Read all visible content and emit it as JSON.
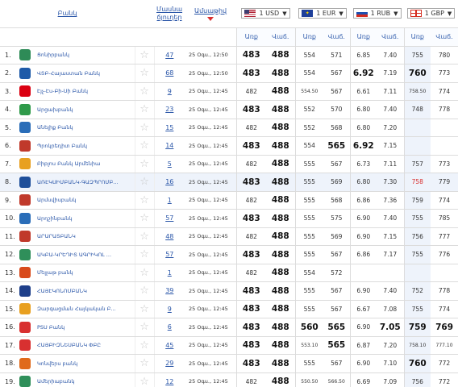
{
  "header": {
    "bank_col": "Բանկ",
    "reviews_col": "Մասնա ճյուղեր",
    "date_col": "Ամսաթիվ",
    "currencies": [
      {
        "code": "1 USD",
        "flag": "usa-flag-icon"
      },
      {
        "code": "1 EUR",
        "flag": "eu-flag-icon"
      },
      {
        "code": "1 RUB",
        "flag": "russia-flag-icon"
      },
      {
        "code": "1 GBP",
        "flag": "uk-flag-icon"
      }
    ],
    "buy_label": "Առք",
    "sell_label": "Վաճ."
  },
  "colors": {
    "link": "#2a56a8",
    "accent_red": "#d83030",
    "highlight": "#eef3fb"
  },
  "rows": [
    {
      "n": "1.",
      "name": "Ցոնիրբանկ",
      "reviews": "47",
      "date": "25 Օգս., 12:50",
      "usd_b": "483",
      "usd_s": "488",
      "eur_b": "554",
      "eur_s": "571",
      "rub_b": "6.85",
      "rub_s": "7.40",
      "gbp_b": "755",
      "gbp_s": "780",
      "logo": "#2e8b57"
    },
    {
      "n": "2.",
      "name": "ՎՏԲ-Հայաստան Բանկ",
      "reviews": "68",
      "date": "25 Օգս., 12:50",
      "usd_b": "483",
      "usd_s": "488",
      "eur_b": "554",
      "eur_s": "567",
      "rub_b": "6.92",
      "rub_s": "7.19",
      "gbp_b": "760",
      "gbp_s": "773",
      "logo": "#1e5aa8"
    },
    {
      "n": "3.",
      "name": "Էյչ-Էս-Բի-Սի Բանկ",
      "reviews": "9",
      "date": "25 Օգս., 12:45",
      "usd_b": "482",
      "usd_s": "488",
      "eur_b": "554.50",
      "eur_s": "567",
      "rub_b": "6.61",
      "rub_s": "7.11",
      "gbp_b": "758.50",
      "gbp_s": "774",
      "logo": "#db0011"
    },
    {
      "n": "4.",
      "name": "Արցախբանկ",
      "reviews": "23",
      "date": "25 Օգս., 12:45",
      "usd_b": "483",
      "usd_s": "488",
      "eur_b": "552",
      "eur_s": "570",
      "rub_b": "6.80",
      "rub_s": "7.40",
      "gbp_b": "748",
      "gbp_s": "778",
      "logo": "#2f9a4a"
    },
    {
      "n": "5.",
      "name": "Անելիք Բանկ",
      "reviews": "15",
      "date": "25 Օգս., 12:45",
      "usd_b": "482",
      "usd_s": "488",
      "eur_b": "552",
      "eur_s": "568",
      "rub_b": "6.80",
      "rub_s": "7.20",
      "gbp_b": "",
      "gbp_s": "",
      "logo": "#2a6db8"
    },
    {
      "n": "6.",
      "name": "Պրոկրեդիտ Բանկ",
      "reviews": "14",
      "date": "25 Օգս., 12:45",
      "usd_b": "483",
      "usd_s": "488",
      "eur_b": "554",
      "eur_s": "565",
      "rub_b": "6.92",
      "rub_s": "7.15",
      "gbp_b": "",
      "gbp_s": "",
      "logo": "#c0392b"
    },
    {
      "n": "7.",
      "name": "Բիբլոս Բանկ Արմենիա",
      "reviews": "5",
      "date": "25 Օգս., 12:45",
      "usd_b": "482",
      "usd_s": "488",
      "eur_b": "555",
      "eur_s": "567",
      "rub_b": "6.73",
      "rub_s": "7.11",
      "gbp_b": "757",
      "gbp_s": "773",
      "logo": "#e8a020"
    },
    {
      "n": "8.",
      "name": "ԱՌԷԿՍԻՄԲԱՆԿ-ԳԱԶՊՐՈՄԲ...",
      "reviews": "16",
      "date": "25 Օգս., 12:45",
      "usd_b": "483",
      "usd_s": "488",
      "eur_b": "555",
      "eur_s": "569",
      "rub_b": "6.80",
      "rub_s": "7.30",
      "gbp_b": "758",
      "gbp_s": "779",
      "logo": "#1e4f9a"
    },
    {
      "n": "9.",
      "name": "Արմսվիսբանկ",
      "reviews": "1",
      "date": "25 Օգս., 12:45",
      "usd_b": "482",
      "usd_s": "488",
      "eur_b": "555",
      "eur_s": "568",
      "rub_b": "6.86",
      "rub_s": "7.36",
      "gbp_b": "759",
      "gbp_s": "774",
      "logo": "#c0392b"
    },
    {
      "n": "10.",
      "name": "Արդշինբանկ",
      "reviews": "57",
      "date": "25 Օգս., 12:45",
      "usd_b": "483",
      "usd_s": "488",
      "eur_b": "555",
      "eur_s": "575",
      "rub_b": "6.90",
      "rub_s": "7.40",
      "gbp_b": "755",
      "gbp_s": "785",
      "logo": "#2a6db8"
    },
    {
      "n": "11.",
      "name": "ԱՐԱՐԱՏԲԱՆԿ",
      "reviews": "48",
      "date": "25 Օգս., 12:45",
      "usd_b": "482",
      "usd_s": "488",
      "eur_b": "555",
      "eur_s": "569",
      "rub_b": "6.90",
      "rub_s": "7.15",
      "gbp_b": "756",
      "gbp_s": "777",
      "logo": "#c0392b"
    },
    {
      "n": "12.",
      "name": "ԱԿԲԱ-ԿՐԵԴԻՏ ԱԳՐԻԿՈԼ ...",
      "reviews": "57",
      "date": "25 Օգս., 12:45",
      "usd_b": "483",
      "usd_s": "488",
      "eur_b": "555",
      "eur_s": "567",
      "rub_b": "6.86",
      "rub_s": "7.17",
      "gbp_b": "755",
      "gbp_s": "776",
      "logo": "#2f8f5a"
    },
    {
      "n": "13.",
      "name": "Մելլաթ բանկ",
      "reviews": "1",
      "date": "25 Օգս., 12:45",
      "usd_b": "482",
      "usd_s": "488",
      "eur_b": "554",
      "eur_s": "572",
      "rub_b": "",
      "rub_s": "",
      "gbp_b": "",
      "gbp_s": "",
      "logo": "#d84a1b"
    },
    {
      "n": "14.",
      "name": "ՀԱՅԷԿՈՆՈՄԲԱՆԿ",
      "reviews": "39",
      "date": "25 Օգս., 12:45",
      "usd_b": "483",
      "usd_s": "488",
      "eur_b": "555",
      "eur_s": "567",
      "rub_b": "6.90",
      "rub_s": "7.40",
      "gbp_b": "752",
      "gbp_s": "778",
      "logo": "#1e3f8a"
    },
    {
      "n": "15.",
      "name": "Զարգացման Հայկական Բ...",
      "reviews": "9",
      "date": "25 Օգս., 12:45",
      "usd_b": "483",
      "usd_s": "488",
      "eur_b": "555",
      "eur_s": "567",
      "rub_b": "6.67",
      "rub_s": "7.08",
      "gbp_b": "755",
      "gbp_s": "774",
      "logo": "#e8a020"
    },
    {
      "n": "16.",
      "name": "PSU Բանկ",
      "reviews": "6",
      "date": "25 Օգս., 12:45",
      "usd_b": "483",
      "usd_s": "488",
      "eur_b": "560",
      "eur_s": "565",
      "rub_b": "6.90",
      "rub_s": "7.05",
      "gbp_b": "759",
      "gbp_s": "769",
      "logo": "#d83030"
    },
    {
      "n": "17.",
      "name": "ՀԱՅԲԻԶՆԵՍԲԱՆԿ ՓԲԸ",
      "reviews": "45",
      "date": "25 Օգս., 12:45",
      "usd_b": "483",
      "usd_s": "488",
      "eur_b": "553.10",
      "eur_s": "565",
      "rub_b": "6.87",
      "rub_s": "7.20",
      "gbp_b": "758.10",
      "gbp_s": "777.10",
      "logo": "#d83030"
    },
    {
      "n": "18.",
      "name": "Կոնվերս բանկ",
      "reviews": "29",
      "date": "25 Օգս., 12:45",
      "usd_b": "483",
      "usd_s": "488",
      "eur_b": "555",
      "eur_s": "567",
      "rub_b": "6.90",
      "rub_s": "7.10",
      "gbp_b": "760",
      "gbp_s": "772",
      "logo": "#e06a1b"
    },
    {
      "n": "19.",
      "name": "Ամերիաբանկ",
      "reviews": "12",
      "date": "25 Օգս., 12:45",
      "usd_b": "482",
      "usd_s": "488",
      "eur_b": "550.50",
      "eur_s": "566.50",
      "rub_b": "6.69",
      "rub_s": "7.09",
      "gbp_b": "756",
      "gbp_s": "772",
      "logo": "#2f8f5a"
    }
  ]
}
